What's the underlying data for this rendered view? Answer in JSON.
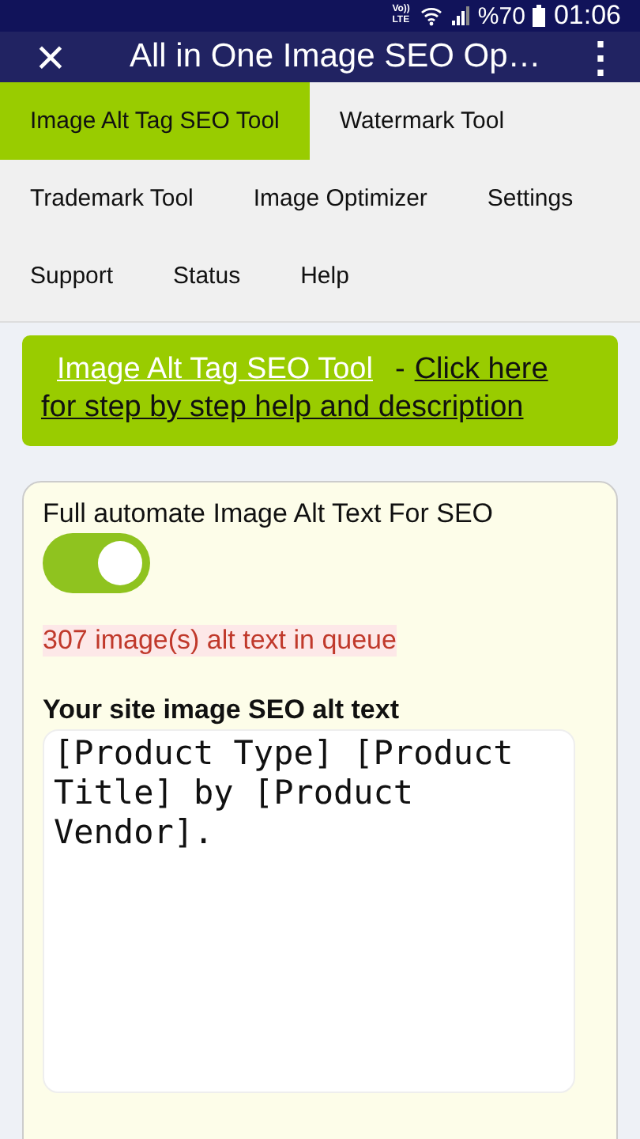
{
  "status_bar": {
    "network_lines": [
      "Vo))",
      "LTE"
    ],
    "battery_text": "%70",
    "time": "01:06"
  },
  "app_bar": {
    "close": "×",
    "title": "All in One Image SEO Op…",
    "menu": "⋮"
  },
  "tabs": [
    {
      "label": "Image Alt Tag SEO Tool",
      "selected": true
    },
    {
      "label": "Watermark Tool",
      "selected": false
    },
    {
      "label": "Trademark Tool",
      "selected": false
    },
    {
      "label": "Image Optimizer",
      "selected": false
    },
    {
      "label": "Settings",
      "selected": false
    },
    {
      "label": "Support",
      "selected": false
    },
    {
      "label": "Status",
      "selected": false
    },
    {
      "label": "Help",
      "selected": false
    }
  ],
  "banner": {
    "tool_link": "Image Alt Tag SEO Tool",
    "separator": "-",
    "help_link_lines": [
      "Click here",
      "for step by step help and description"
    ]
  },
  "card": {
    "toggle_label": "Full automate Image Alt Text For SEO",
    "toggle_on": true,
    "queue_text": "307 image(s) alt text in queue",
    "alt_label": "Your site image SEO alt text",
    "alt_value": "[Product Type] [Product Title] by [Product Vendor]."
  }
}
